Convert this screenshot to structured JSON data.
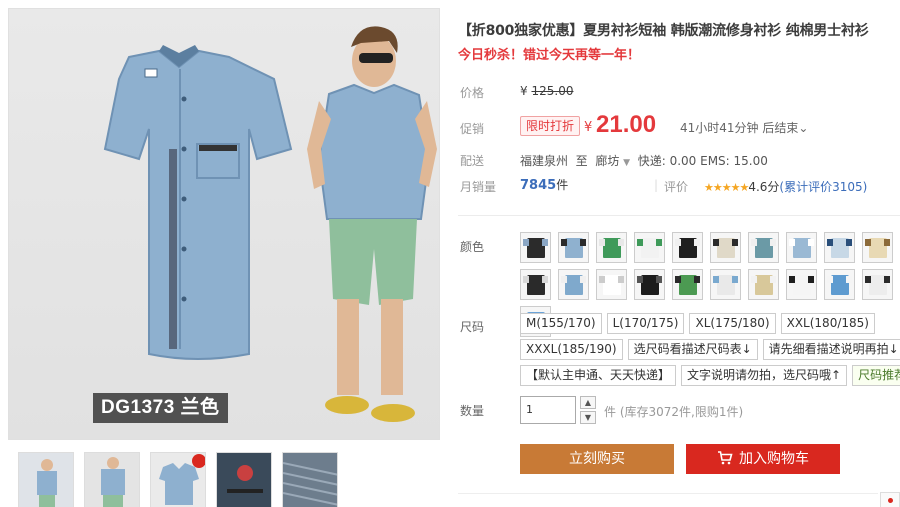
{
  "gallery": {
    "main_tag": "DG1373 兰色",
    "thumbnails": [
      "thumb-model-front",
      "thumb-model-side",
      "thumb-shirt-badge",
      "thumb-pocket-detail",
      "thumb-stripe-detail"
    ]
  },
  "product": {
    "title": "【折800独家优惠】夏男衬衫短袖 韩版潮流修身衬衫 纯棉男士衬衫",
    "subtitle": "今日秒杀！错过今天再等一年！"
  },
  "price": {
    "original_label": "价格",
    "currency": "¥",
    "original_value": "125.00",
    "promo_label": "促销",
    "promo_tag": "限时打折",
    "promo_value": "21.00",
    "countdown": "41小时41分钟 后结束",
    "shipping_label": "配送",
    "ship_from": "福建泉州",
    "ship_to_word": "至",
    "ship_to": "廊坊",
    "shipping_fees": "快递: 0.00 EMS: 15.00",
    "sales_label": "月销量",
    "sales_value": "7845",
    "sales_unit": "件",
    "rating_label": "评价",
    "rating_stars": "★★★★★",
    "rating_score": "4.6分",
    "rating_count": "(累计评价3105)"
  },
  "options": {
    "color_label": "颜色",
    "swatches": [
      {
        "body": "#2b2b2b",
        "sleeve": "#8aa6c4"
      },
      {
        "body": "#8fb1cf",
        "sleeve": "#2b2b2b"
      },
      {
        "body": "#3f9a5a",
        "sleeve": "#e8e8e8"
      },
      {
        "body": "#f2f2f2",
        "sleeve": "#3f9a5a"
      },
      {
        "body": "#1f1f1f",
        "sleeve": "#f0f0f0"
      },
      {
        "body": "#e0d9c8",
        "sleeve": "#2b2b2b"
      },
      {
        "body": "#6b9aa6",
        "sleeve": "#f0f0f0"
      },
      {
        "body": "#9ab9d4",
        "sleeve": "#ffffff"
      },
      {
        "body": "#c7d8e6",
        "sleeve": "#2a4f7a"
      },
      {
        "body": "#e8d9b4",
        "sleeve": "#8b6a3a"
      },
      {
        "body": "#2a2a2a",
        "sleeve": "#d8d8d8"
      },
      {
        "body": "#7fa9cc",
        "sleeve": "#f0f0f0"
      },
      {
        "body": "#ffffff",
        "sleeve": "#cccccc"
      },
      {
        "body": "#1c1c1c",
        "sleeve": "#555555"
      },
      {
        "body": "#4c9a52",
        "sleeve": "#2a2a2a"
      },
      {
        "body": "#e9e9e9",
        "sleeve": "#7aa9cf"
      },
      {
        "body": "#d8c89a",
        "sleeve": "#f2f2f2"
      },
      {
        "body": "#f5f5f5",
        "sleeve": "#1f1f1f"
      },
      {
        "body": "#5e9bd0",
        "sleeve": "#f5f5f5"
      },
      {
        "body": "#ededed",
        "sleeve": "#2b2b2b"
      },
      {
        "body": "#6aa3d8",
        "sleeve": "#1e1e1e"
      }
    ],
    "size_label": "尺码",
    "size_rows": [
      [
        "M(155/170)",
        "L(170/175)",
        "XL(175/180)",
        "XXL(180/185)"
      ],
      [
        "XXXL(185/190)",
        "选尺码看描述尺码表↓",
        "请先细看描述说明再拍↓"
      ],
      [
        "【默认主申通、天天快递】",
        "文字说明请勿拍，选尺码哦↑",
        "尺码推荐"
      ]
    ]
  },
  "quantity": {
    "label": "数量",
    "value": "1",
    "unit_and_stock": "件 (库存3072件,限购1件)"
  },
  "actions": {
    "buy_now": "立刻购买",
    "add_cart": "加入购物车"
  }
}
